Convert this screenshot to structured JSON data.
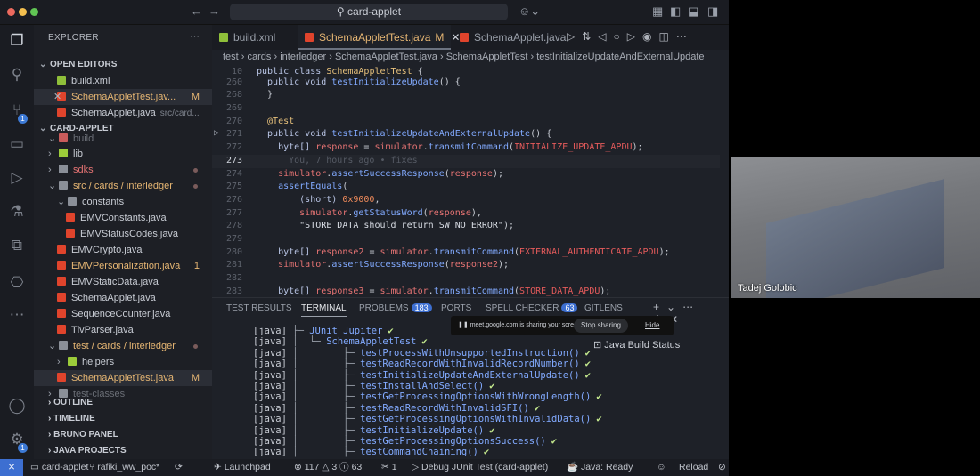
{
  "window": {
    "search": "card-applet"
  },
  "colors": {
    "accent": "#3d6fd1",
    "java_icon": "#e0442c",
    "modified": "#e6b673"
  },
  "sidebar": {
    "title": "EXPLORER",
    "rows": [
      {
        "label": "OPEN EDITORS",
        "indent": 0,
        "type": "hdr",
        "chev": "v"
      },
      {
        "label": "build.xml",
        "indent": 2,
        "icon": "xml"
      },
      {
        "label": "SchemaAppletTest.jav...",
        "indent": 2,
        "icon": "java",
        "mark": "M",
        "sel": true,
        "close": "✕",
        "color": "#e6b673"
      },
      {
        "label": "SchemaApplet.java",
        "extra": "src/card...",
        "indent": 2,
        "icon": "java"
      },
      {
        "label": "CARD-APPLET",
        "indent": 0,
        "type": "hdr",
        "chev": "v"
      },
      {
        "label": "build",
        "indent": 1,
        "icon": "fold-r",
        "chev": "v",
        "color": "#6a6e76"
      },
      {
        "label": "lib",
        "indent": 1,
        "icon": "fold-g",
        "chev": ">"
      },
      {
        "label": "sdks",
        "indent": 1,
        "icon": "fold",
        "chev": ">",
        "color": "#e57373",
        "dot": true
      },
      {
        "label": "src / cards / interledger",
        "indent": 1,
        "icon": "fold",
        "chev": "v",
        "color": "#e6b673",
        "dot": true
      },
      {
        "label": "constants",
        "indent": 2,
        "icon": "fold",
        "chev": "v"
      },
      {
        "label": "EMVConstants.java",
        "indent": 3,
        "icon": "java"
      },
      {
        "label": "EMVStatusCodes.java",
        "indent": 3,
        "icon": "java"
      },
      {
        "label": "EMVCrypto.java",
        "indent": 2,
        "icon": "java"
      },
      {
        "label": "EMVPersonalization.java",
        "indent": 2,
        "icon": "java",
        "mark": "1",
        "color": "#e6b673"
      },
      {
        "label": "EMVStaticData.java",
        "indent": 2,
        "icon": "java"
      },
      {
        "label": "SchemaApplet.java",
        "indent": 2,
        "icon": "java"
      },
      {
        "label": "SequenceCounter.java",
        "indent": 2,
        "icon": "java"
      },
      {
        "label": "TlvParser.java",
        "indent": 2,
        "icon": "java"
      },
      {
        "label": "test / cards / interledger",
        "indent": 1,
        "icon": "fold",
        "chev": "v",
        "color": "#e6b673",
        "dot": true
      },
      {
        "label": "helpers",
        "indent": 2,
        "icon": "fold-g",
        "chev": ">"
      },
      {
        "label": "SchemaAppletTest.java",
        "indent": 2,
        "icon": "java",
        "mark": "M",
        "sel": true,
        "color": "#e6b673"
      },
      {
        "label": "test-classes",
        "indent": 1,
        "icon": "fold",
        "chev": ">",
        "color": "#6a6e76"
      }
    ],
    "sections": [
      "OUTLINE",
      "TIMELINE",
      "BRUNO PANEL",
      "JAVA PROJECTS"
    ]
  },
  "activity": {
    "scm_badge": "1",
    "settings_badge": "1"
  },
  "tabs": [
    {
      "label": "build.xml",
      "icon": "xml"
    },
    {
      "label": "SchemaAppletTest.java",
      "mark": "M",
      "close": "✕",
      "active": true,
      "icon": "java"
    },
    {
      "label": "SchemaApplet.java",
      "icon": "java"
    }
  ],
  "breadcrumbs": [
    "test",
    "cards",
    "interledger",
    "SchemaAppletTest.java",
    "SchemaAppletTest",
    "testInitializeUpdateAndExternalUpdate"
  ],
  "code": [
    {
      "n": "10",
      "t": [
        [
          "public class ",
          "kw"
        ],
        [
          "SchemaAppletTest",
          "cls"
        ],
        [
          " {",
          "pl"
        ]
      ]
    },
    {
      "n": "260",
      "t": [
        [
          "  public void ",
          "kw"
        ],
        [
          "testInitializeUpdate",
          "fn"
        ],
        [
          "() {",
          "pl"
        ]
      ]
    },
    {
      "n": "268",
      "t": [
        [
          "  }",
          "pl"
        ]
      ]
    },
    {
      "n": "269",
      "t": []
    },
    {
      "n": "270",
      "t": [
        [
          "  @Test",
          "an"
        ]
      ]
    },
    {
      "n": "271",
      "t": [
        [
          "  public void ",
          "kw"
        ],
        [
          "testInitializeUpdateAndExternalUpdate",
          "fn"
        ],
        [
          "() {",
          "pl"
        ]
      ]
    },
    {
      "n": "272",
      "t": [
        [
          "    byte[] ",
          "kw"
        ],
        [
          "response",
          "id"
        ],
        [
          " = ",
          "pl"
        ],
        [
          "simulator",
          "id"
        ],
        [
          ".",
          "pl"
        ],
        [
          "transmitCommand",
          "fn"
        ],
        [
          "(",
          "pl"
        ],
        [
          "INITIALIZE_UPDATE_APDU",
          "k"
        ],
        [
          ");",
          "pl"
        ]
      ]
    },
    {
      "n": "273",
      "cur": true,
      "t": [
        [
          "      You, 7 hours ago • fixes",
          "gh"
        ]
      ]
    },
    {
      "n": "274",
      "t": [
        [
          "    simulator",
          "id"
        ],
        [
          ".",
          "pl"
        ],
        [
          "assertSuccessResponse",
          "fn"
        ],
        [
          "(",
          "pl"
        ],
        [
          "response",
          "id"
        ],
        [
          ");",
          "pl"
        ]
      ]
    },
    {
      "n": "275",
      "t": [
        [
          "    assertEquals",
          "fn"
        ],
        [
          "(",
          "pl"
        ]
      ]
    },
    {
      "n": "276",
      "t": [
        [
          "        (short) ",
          "kw"
        ],
        [
          "0x9000",
          "num"
        ],
        [
          ",",
          "pl"
        ]
      ]
    },
    {
      "n": "277",
      "t": [
        [
          "        simulator",
          "id"
        ],
        [
          ".",
          "pl"
        ],
        [
          "getStatusWord",
          "fn"
        ],
        [
          "(",
          "pl"
        ],
        [
          "response",
          "id"
        ],
        [
          "),",
          "pl"
        ]
      ]
    },
    {
      "n": "278",
      "t": [
        [
          "        \"STORE DATA should return SW_NO_ERROR\"",
          "str"
        ],
        [
          ");",
          "pl"
        ]
      ]
    },
    {
      "n": "279",
      "t": []
    },
    {
      "n": "280",
      "t": [
        [
          "    byte[] ",
          "kw"
        ],
        [
          "response2",
          "id"
        ],
        [
          " = ",
          "pl"
        ],
        [
          "simulator",
          "id"
        ],
        [
          ".",
          "pl"
        ],
        [
          "transmitCommand",
          "fn"
        ],
        [
          "(",
          "pl"
        ],
        [
          "EXTERNAL_AUTHENTICATE_APDU",
          "k"
        ],
        [
          ");",
          "pl"
        ]
      ]
    },
    {
      "n": "281",
      "t": [
        [
          "    simulator",
          "id"
        ],
        [
          ".",
          "pl"
        ],
        [
          "assertSuccessResponse",
          "fn"
        ],
        [
          "(",
          "pl"
        ],
        [
          "response2",
          "id"
        ],
        [
          ");",
          "pl"
        ]
      ]
    },
    {
      "n": "282",
      "t": []
    },
    {
      "n": "283",
      "t": [
        [
          "    byte[] ",
          "kw"
        ],
        [
          "response3",
          "id"
        ],
        [
          " = ",
          "pl"
        ],
        [
          "simulator",
          "id"
        ],
        [
          ".",
          "pl"
        ],
        [
          "transmitCommand",
          "fn"
        ],
        [
          "(",
          "pl"
        ],
        [
          "STORE_DATA_APDU",
          "k"
        ],
        [
          ");",
          "pl"
        ]
      ]
    }
  ],
  "panel": {
    "tabs": [
      {
        "label": "TEST RESULTS"
      },
      {
        "label": "TERMINAL",
        "active": true
      },
      {
        "label": "PROBLEMS",
        "badge": "183"
      },
      {
        "label": "PORTS"
      },
      {
        "label": "SPELL CHECKER",
        "badge": "63"
      },
      {
        "label": "GITLENS"
      }
    ],
    "terminal": [
      {
        "p": "[java]",
        "tree": " ├─ ",
        "name": "JUnit Jupiter",
        "ok": "✔"
      },
      {
        "p": "[java]",
        "tree": " │  └─ ",
        "name": "SchemaAppletTest",
        "ok": "✔"
      },
      {
        "p": "[java]",
        "tree": " │        ├─ ",
        "name": "testProcessWithUnsupportedInstruction()",
        "ok": "✔"
      },
      {
        "p": "[java]",
        "tree": " │        ├─ ",
        "name": "testReadRecordWithInvalidRecordNumber()",
        "ok": "✔"
      },
      {
        "p": "[java]",
        "tree": " │        ├─ ",
        "name": "testInitializeUpdateAndExternalUpdate()",
        "ok": "✔"
      },
      {
        "p": "[java]",
        "tree": " │        ├─ ",
        "name": "testInstallAndSelect()",
        "ok": "✔"
      },
      {
        "p": "[java]",
        "tree": " │        ├─ ",
        "name": "testGetProcessingOptionsWithWrongLength()",
        "ok": "✔"
      },
      {
        "p": "[java]",
        "tree": " │        ├─ ",
        "name": "testReadRecordWithInvalidSFI()",
        "ok": "✔"
      },
      {
        "p": "[java]",
        "tree": " │        ├─ ",
        "name": "testGetProcessingOptionsWithInvalidData()",
        "ok": "✔"
      },
      {
        "p": "[java]",
        "tree": " │        ├─ ",
        "name": "testInitializeUpdate()",
        "ok": "✔"
      },
      {
        "p": "[java]",
        "tree": " │        ├─ ",
        "name": "testGetProcessingOptionsSuccess()",
        "ok": "✔"
      },
      {
        "p": "[java]",
        "tree": " │        ├─ ",
        "name": "testCommandChaining()",
        "ok": "✔"
      }
    ],
    "share_text": "meet.google.com is sharing your screen.",
    "stop_sharing": "Stop sharing",
    "hide": "Hide",
    "java_build_status": "Java Build Status"
  },
  "status": {
    "folder": "card-applet",
    "branch": "rafiki_ww_poc*",
    "launchpad": "Launchpad",
    "errors": "117",
    "warnings": "3",
    "infos": "63",
    "ports": "1",
    "debug": "Debug JUnit Test (card-applet)",
    "java": "Java: Ready",
    "reload": "Reload"
  },
  "video": {
    "name": "Tadej Golobic"
  }
}
